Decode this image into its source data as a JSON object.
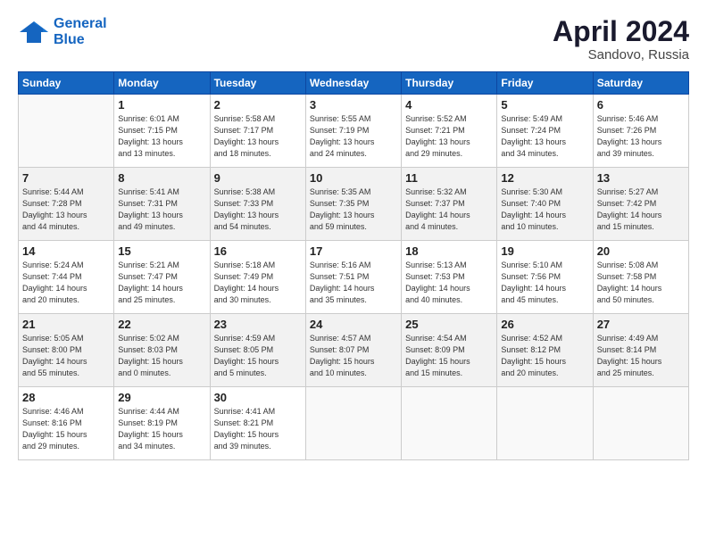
{
  "header": {
    "logo_line1": "General",
    "logo_line2": "Blue",
    "title": "April 2024",
    "location": "Sandovo, Russia"
  },
  "days_of_week": [
    "Sunday",
    "Monday",
    "Tuesday",
    "Wednesday",
    "Thursday",
    "Friday",
    "Saturday"
  ],
  "weeks": [
    [
      {
        "day": "",
        "info": ""
      },
      {
        "day": "1",
        "info": "Sunrise: 6:01 AM\nSunset: 7:15 PM\nDaylight: 13 hours\nand 13 minutes."
      },
      {
        "day": "2",
        "info": "Sunrise: 5:58 AM\nSunset: 7:17 PM\nDaylight: 13 hours\nand 18 minutes."
      },
      {
        "day": "3",
        "info": "Sunrise: 5:55 AM\nSunset: 7:19 PM\nDaylight: 13 hours\nand 24 minutes."
      },
      {
        "day": "4",
        "info": "Sunrise: 5:52 AM\nSunset: 7:21 PM\nDaylight: 13 hours\nand 29 minutes."
      },
      {
        "day": "5",
        "info": "Sunrise: 5:49 AM\nSunset: 7:24 PM\nDaylight: 13 hours\nand 34 minutes."
      },
      {
        "day": "6",
        "info": "Sunrise: 5:46 AM\nSunset: 7:26 PM\nDaylight: 13 hours\nand 39 minutes."
      }
    ],
    [
      {
        "day": "7",
        "info": "Sunrise: 5:44 AM\nSunset: 7:28 PM\nDaylight: 13 hours\nand 44 minutes."
      },
      {
        "day": "8",
        "info": "Sunrise: 5:41 AM\nSunset: 7:31 PM\nDaylight: 13 hours\nand 49 minutes."
      },
      {
        "day": "9",
        "info": "Sunrise: 5:38 AM\nSunset: 7:33 PM\nDaylight: 13 hours\nand 54 minutes."
      },
      {
        "day": "10",
        "info": "Sunrise: 5:35 AM\nSunset: 7:35 PM\nDaylight: 13 hours\nand 59 minutes."
      },
      {
        "day": "11",
        "info": "Sunrise: 5:32 AM\nSunset: 7:37 PM\nDaylight: 14 hours\nand 4 minutes."
      },
      {
        "day": "12",
        "info": "Sunrise: 5:30 AM\nSunset: 7:40 PM\nDaylight: 14 hours\nand 10 minutes."
      },
      {
        "day": "13",
        "info": "Sunrise: 5:27 AM\nSunset: 7:42 PM\nDaylight: 14 hours\nand 15 minutes."
      }
    ],
    [
      {
        "day": "14",
        "info": "Sunrise: 5:24 AM\nSunset: 7:44 PM\nDaylight: 14 hours\nand 20 minutes."
      },
      {
        "day": "15",
        "info": "Sunrise: 5:21 AM\nSunset: 7:47 PM\nDaylight: 14 hours\nand 25 minutes."
      },
      {
        "day": "16",
        "info": "Sunrise: 5:18 AM\nSunset: 7:49 PM\nDaylight: 14 hours\nand 30 minutes."
      },
      {
        "day": "17",
        "info": "Sunrise: 5:16 AM\nSunset: 7:51 PM\nDaylight: 14 hours\nand 35 minutes."
      },
      {
        "day": "18",
        "info": "Sunrise: 5:13 AM\nSunset: 7:53 PM\nDaylight: 14 hours\nand 40 minutes."
      },
      {
        "day": "19",
        "info": "Sunrise: 5:10 AM\nSunset: 7:56 PM\nDaylight: 14 hours\nand 45 minutes."
      },
      {
        "day": "20",
        "info": "Sunrise: 5:08 AM\nSunset: 7:58 PM\nDaylight: 14 hours\nand 50 minutes."
      }
    ],
    [
      {
        "day": "21",
        "info": "Sunrise: 5:05 AM\nSunset: 8:00 PM\nDaylight: 14 hours\nand 55 minutes."
      },
      {
        "day": "22",
        "info": "Sunrise: 5:02 AM\nSunset: 8:03 PM\nDaylight: 15 hours\nand 0 minutes."
      },
      {
        "day": "23",
        "info": "Sunrise: 4:59 AM\nSunset: 8:05 PM\nDaylight: 15 hours\nand 5 minutes."
      },
      {
        "day": "24",
        "info": "Sunrise: 4:57 AM\nSunset: 8:07 PM\nDaylight: 15 hours\nand 10 minutes."
      },
      {
        "day": "25",
        "info": "Sunrise: 4:54 AM\nSunset: 8:09 PM\nDaylight: 15 hours\nand 15 minutes."
      },
      {
        "day": "26",
        "info": "Sunrise: 4:52 AM\nSunset: 8:12 PM\nDaylight: 15 hours\nand 20 minutes."
      },
      {
        "day": "27",
        "info": "Sunrise: 4:49 AM\nSunset: 8:14 PM\nDaylight: 15 hours\nand 25 minutes."
      }
    ],
    [
      {
        "day": "28",
        "info": "Sunrise: 4:46 AM\nSunset: 8:16 PM\nDaylight: 15 hours\nand 29 minutes."
      },
      {
        "day": "29",
        "info": "Sunrise: 4:44 AM\nSunset: 8:19 PM\nDaylight: 15 hours\nand 34 minutes."
      },
      {
        "day": "30",
        "info": "Sunrise: 4:41 AM\nSunset: 8:21 PM\nDaylight: 15 hours\nand 39 minutes."
      },
      {
        "day": "",
        "info": ""
      },
      {
        "day": "",
        "info": ""
      },
      {
        "day": "",
        "info": ""
      },
      {
        "day": "",
        "info": ""
      }
    ]
  ]
}
